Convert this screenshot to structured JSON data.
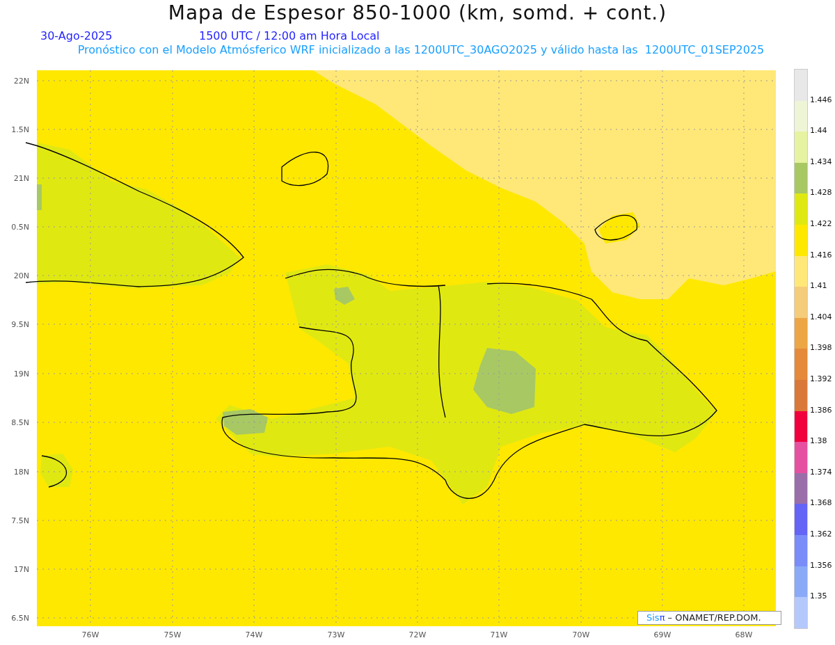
{
  "title": "Mapa de Espesor 850-1000 (km, somd. + cont.)",
  "date": "30-Ago-2025",
  "time": "1500 UTC / 12:00 am Hora Local",
  "forecast": "Pronóstico con el Modelo Atmósferico WRF inicializado a las 1200UTC_30AGO2025 y válido hasta las  1200UTC_01SEP2025",
  "y_axis": [
    "22N",
    "1.5N",
    "21N",
    "0.5N",
    "20N",
    "9.5N",
    "19N",
    "8.5N",
    "18N",
    "7.5N",
    "17N",
    "6.5N"
  ],
  "x_axis": [
    "76W",
    "75W",
    "74W",
    "73W",
    "72W",
    "71W",
    "70W",
    "69W",
    "68W"
  ],
  "colorbar": [
    {
      "color": "#e8e8e8",
      "label": "1.446"
    },
    {
      "color": "#eef5d6",
      "label": "1.44"
    },
    {
      "color": "#e6f3a0",
      "label": "1.434"
    },
    {
      "color": "#a8c864",
      "label": "1.428"
    },
    {
      "color": "#e0e812",
      "label": "1.422"
    },
    {
      "color": "#ffe800",
      "label": "1.416"
    },
    {
      "color": "#ffe878",
      "label": "1.41"
    },
    {
      "color": "#f5cc7a",
      "label": "1.404"
    },
    {
      "color": "#eca646",
      "label": "1.398"
    },
    {
      "color": "#e48a3a",
      "label": "1.392"
    },
    {
      "color": "#da783a",
      "label": "1.386"
    },
    {
      "color": "#f0003c",
      "label": "1.38"
    },
    {
      "color": "#e650a0",
      "label": "1.374"
    },
    {
      "color": "#9a6ea8",
      "label": "1.368"
    },
    {
      "color": "#6464f6",
      "label": "1.362"
    },
    {
      "color": "#7a8cf8",
      "label": "1.356"
    },
    {
      "color": "#8aaaf8",
      "label": "1.35"
    },
    {
      "color": "#b4c8fc"
    }
  ],
  "logo": {
    "sis": "Sis",
    "pi": "π",
    "org": " – ONAMET/REP.DOM."
  }
}
